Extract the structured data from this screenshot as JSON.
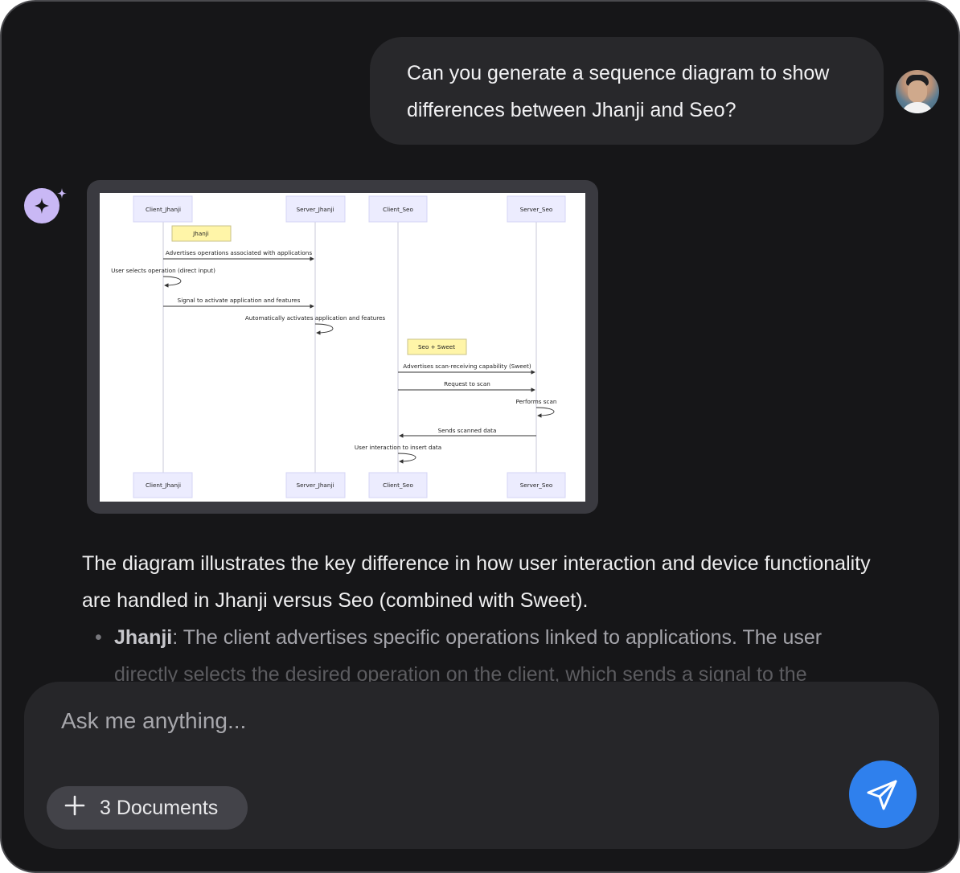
{
  "chat": {
    "user_message": "Can you generate a sequence diagram to show differences between Jhanji and Seo?",
    "response_paragraph": "The diagram illustrates the key difference in how user interaction and device functionality are handled in Jhanji versus Seo (combined with Sweet).",
    "bullet_dot": "•",
    "bullet_term": "Jhanji",
    "bullet_text": ": The client advertises specific operations linked to applications. The user",
    "bullet_text_faded": "directly selects the desired operation on the client, which sends a signal to the"
  },
  "diagram": {
    "participants": [
      "Client_Jhanji",
      "Server_Jhanji",
      "Client_Seo",
      "Server_Seo"
    ],
    "notes": [
      "Jhanji",
      "Seo + Sweet"
    ],
    "messages": [
      "Advertises operations associated with applications",
      "User selects operation (direct input)",
      "Signal to activate application and features",
      "Automatically activates application and features",
      "Advertises scan-receiving capability (Sweet)",
      "Request to scan",
      "Performs scan",
      "Sends scanned data",
      "User interaction to insert data"
    ]
  },
  "composer": {
    "placeholder": "Ask me anything...",
    "documents_label": "3 Documents"
  },
  "icons": {
    "assistant": "sparkle-icon",
    "attach": "plus-icon",
    "send": "send-icon"
  },
  "colors": {
    "background": "#161618",
    "accent": "#2f80ed",
    "assistant_icon": "#c9b8f5"
  }
}
